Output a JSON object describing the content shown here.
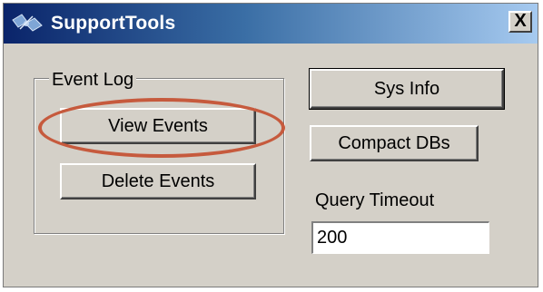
{
  "window": {
    "title": "SupportTools",
    "close_glyph": "X",
    "icon": "satellite-icon"
  },
  "event_log": {
    "group_label": "Event Log",
    "view_events_label": "View Events",
    "delete_events_label": "Delete Events"
  },
  "tools": {
    "sys_info_label": "Sys Info",
    "compact_dbs_label": "Compact DBs"
  },
  "query_timeout": {
    "label": "Query Timeout",
    "value": "200"
  },
  "colors": {
    "highlight_oval": "#c65a3d",
    "title_bar_start": "#0a246a",
    "title_bar_end": "#a6caf0",
    "window_bg": "#d4d0c8"
  }
}
